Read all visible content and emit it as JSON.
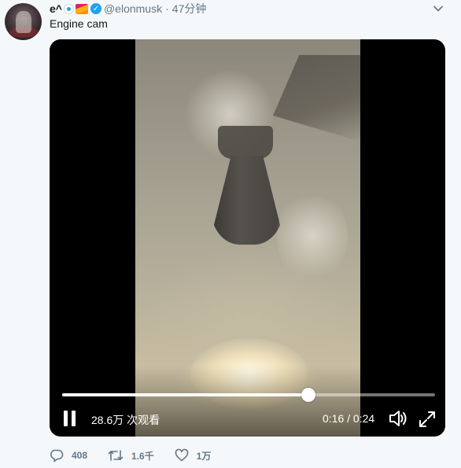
{
  "tweet": {
    "display_name": "e^",
    "emoji": [
      "eye-emoji",
      "pizza-emoji"
    ],
    "verified": true,
    "handle": "@elonmusk",
    "separator": "·",
    "timestamp": "47分钟",
    "text": "Engine cam"
  },
  "video": {
    "views": "28.6万 次观看",
    "timecode": "0:16 / 0:24",
    "progress": 0.66,
    "playing": true
  },
  "actions": {
    "replies": "408",
    "retweets": "1.6千",
    "likes": "1万"
  },
  "colors": {
    "accent": "#1da1f2",
    "muted_text": "#657786",
    "background": "#f5f8fa"
  }
}
